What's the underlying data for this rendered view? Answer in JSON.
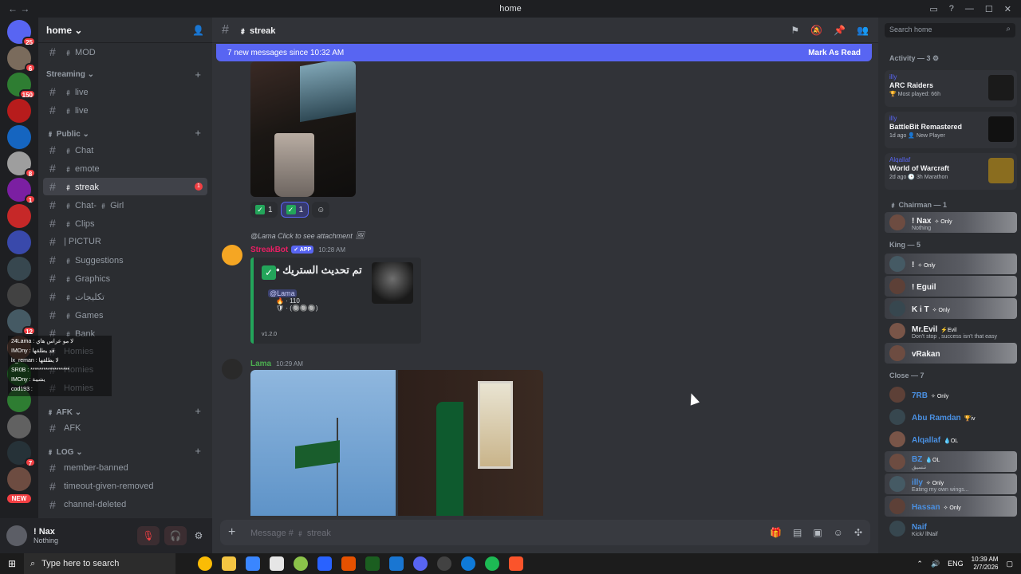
{
  "window": {
    "title": "home"
  },
  "servers": [
    {
      "badge": "25",
      "color": "#5865f2"
    },
    {
      "badge": "6",
      "color": "#7a6b5c"
    },
    {
      "badge": "150",
      "color": "#2e7d32"
    },
    {
      "badge": "",
      "color": "#b71c1c"
    },
    {
      "badge": "",
      "color": "#1565c0"
    },
    {
      "badge": "8",
      "color": "#9e9e9e"
    },
    {
      "badge": "1",
      "color": "#7b1fa2"
    },
    {
      "badge": "",
      "color": "#c62828"
    },
    {
      "badge": "",
      "color": "#3949ab"
    },
    {
      "badge": "",
      "color": "#37474f"
    },
    {
      "badge": "",
      "color": "#424242"
    },
    {
      "badge": "12",
      "color": "#455a64"
    },
    {
      "badge": "",
      "color": "#5d4037"
    },
    {
      "badge": "",
      "color": "#1b5e20"
    },
    {
      "badge": "",
      "color": "#2e7d32"
    },
    {
      "badge": "",
      "color": "#616161"
    },
    {
      "badge": "7",
      "color": "#263238"
    },
    {
      "badge": "",
      "color": "#6d4c41"
    }
  ],
  "new_label": "NEW",
  "guild": {
    "name": "home ⌄"
  },
  "channels": {
    "top": [
      {
        "label": "﹟ MOD"
      }
    ],
    "streaming": {
      "name": "Streaming ⌄",
      "items": [
        {
          "label": "﹟ live"
        },
        {
          "label": "﹟ live"
        }
      ]
    },
    "public": {
      "name": "﹟ Public ⌄",
      "items": [
        {
          "label": "﹟ Chat"
        },
        {
          "label": "﹟ emote"
        },
        {
          "label": "﹟ streak",
          "active": true,
          "badge": "1"
        },
        {
          "label": "﹟ Chat- ﹟ Girl"
        },
        {
          "label": "﹟ Clips"
        },
        {
          "label": "| PICTUR"
        },
        {
          "label": "﹟ Suggestions"
        },
        {
          "label": "﹟ Graphics"
        },
        {
          "label": "﹟ تكليجات"
        },
        {
          "label": "﹟ Games"
        },
        {
          "label": "﹟ Bank"
        },
        {
          "label": "Homies"
        },
        {
          "label": "Homies"
        },
        {
          "label": "Homies"
        }
      ]
    },
    "afk": {
      "name": "﹟ AFK ⌄",
      "items": [
        {
          "label": "AFK"
        }
      ]
    },
    "log": {
      "name": "﹟ LOG ⌄",
      "items": [
        {
          "label": "member-banned"
        },
        {
          "label": "timeout-given-removed"
        },
        {
          "label": "channel-deleted"
        }
      ]
    }
  },
  "user": {
    "name": "! Nax",
    "status": "Nothing"
  },
  "chat": {
    "channel": "﹟ streak",
    "new_messages": "7 new messages since 10:32 AM",
    "mark_read": "Mark As Read",
    "reactions": [
      {
        "count": "1"
      },
      {
        "count": "1"
      }
    ],
    "reply_text": "@Lama Click to see attachment",
    "bot": {
      "name": "StreakBot",
      "tag": "✓ APP",
      "time": "10:28 AM"
    },
    "embed": {
      "title": "تم تحديث الستريك •",
      "mention": "@Lama",
      "line1": "· 110",
      "line2": "· (🔘🔘🔘)",
      "version": "v1.2.0"
    },
    "msg2": {
      "author": "Lama",
      "time": "10:29 AM"
    },
    "placeholder": "Message # ﹟ streak"
  },
  "members": {
    "search_placeholder": "Search home",
    "activity_header": "Activity — 3",
    "activities": [
      {
        "user": "illy",
        "game": "ARC Raiders",
        "meta": "🏆 Most played: 66h",
        "art": "#1a1a1a"
      },
      {
        "user": "illy",
        "game": "BattleBit Remastered",
        "meta": "1d ago  👤 New Player",
        "art": "#111111"
      },
      {
        "user": "Alqallaf",
        "game": "World of Warcraft",
        "meta": "2d ago  🕒 3h Marathon",
        "art": "#8a6d1f"
      }
    ],
    "groups": [
      {
        "name": "﹟ Chairman — 1",
        "members": [
          {
            "name": "! Nax",
            "tag": "✧ Only",
            "status": "Nothing",
            "color": "#f2f3f5",
            "hl": true
          }
        ]
      },
      {
        "name": "King — 5",
        "members": [
          {
            "name": "!",
            "tag": "✧ Only",
            "status": "",
            "color": "#f2f3f5",
            "hl": true
          },
          {
            "name": "! Eguil",
            "tag": "",
            "status": "",
            "color": "#f2f3f5",
            "hl": true
          },
          {
            "name": "K i T",
            "tag": "✧ Only",
            "status": "",
            "color": "#f2f3f5",
            "hl": true
          },
          {
            "name": "Mr.Evil",
            "tag": "⚡Evil",
            "status": "Don't stop , success isn't that easy",
            "color": "#f2f3f5",
            "hl": false
          },
          {
            "name": "vRakan",
            "tag": "",
            "status": "",
            "color": "#f2f3f5",
            "hl": true
          }
        ]
      },
      {
        "name": "Close — 7",
        "members": [
          {
            "name": "7RB",
            "tag": "✧ Only",
            "status": "",
            "color": "#4a90e2",
            "hl": false
          },
          {
            "name": "Abu Ramdan",
            "tag": "🏆iv",
            "status": "",
            "color": "#4a90e2",
            "hl": false
          },
          {
            "name": "Alqallaf",
            "tag": "💧OL",
            "status": "",
            "color": "#4a90e2",
            "hl": false
          },
          {
            "name": "BZ",
            "tag": "💧OL",
            "status": "تنسيق",
            "color": "#4a90e2",
            "hl": true
          },
          {
            "name": "illy",
            "tag": "✧ Only",
            "status": "Eating my own wings...",
            "color": "#4a90e2",
            "hl": true
          },
          {
            "name": "Hassan",
            "tag": "✧ Only",
            "status": "",
            "color": "#4a90e2",
            "hl": true
          },
          {
            "name": "Naif",
            "tag": "",
            "status": "Kick/ llNaif",
            "color": "#4a90e2",
            "hl": false
          }
        ]
      }
    ]
  },
  "taskbar": {
    "search": "Type here to search",
    "lang": "ENG",
    "time": "10:39 AM",
    "date": "2/7/2026"
  }
}
